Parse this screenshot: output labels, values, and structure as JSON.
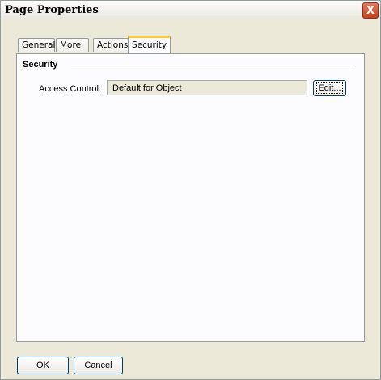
{
  "window": {
    "title": "Page Properties",
    "close_glyph": "X"
  },
  "tabs": [
    {
      "label": "General",
      "active": false
    },
    {
      "label": "More",
      "active": false
    },
    {
      "label": "Actions",
      "active": false
    },
    {
      "label": "Security",
      "active": true
    }
  ],
  "security": {
    "section_title": "Security",
    "access_control_label": "Access Control:",
    "access_control_value": "Default for Object",
    "edit_button": "Edit..."
  },
  "footer": {
    "ok_label": "OK",
    "cancel_label": "Cancel"
  },
  "colors": {
    "window_bg": "#ece9d8",
    "panel_bg": "#fcfcfe",
    "active_tab_accent": "#ffc83c",
    "close_button": "#d04a26",
    "button_border": "#003c74"
  }
}
